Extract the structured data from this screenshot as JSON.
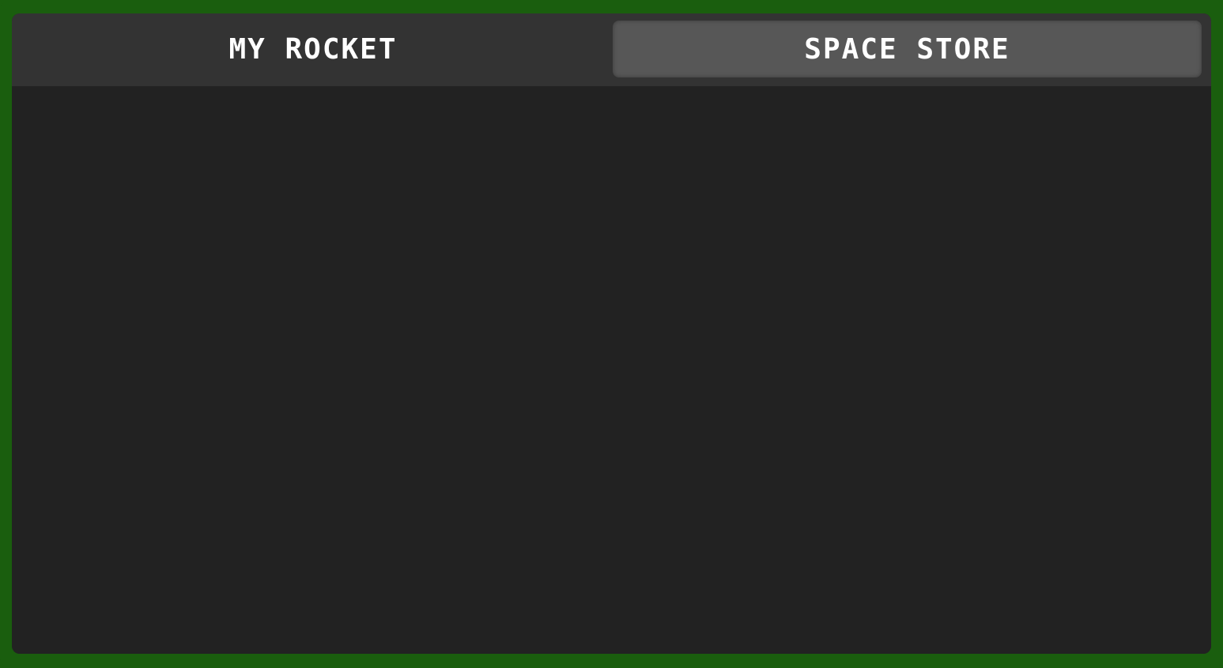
{
  "tabs": [
    {
      "label": "MY ROCKET",
      "active": false
    },
    {
      "label": "SPACE STORE",
      "active": true
    }
  ],
  "colors": {
    "frame": "#1a5e0e",
    "panel": "#222222",
    "tabbar": "#333333",
    "active_tab": "#575757",
    "text": "#ffffff"
  }
}
